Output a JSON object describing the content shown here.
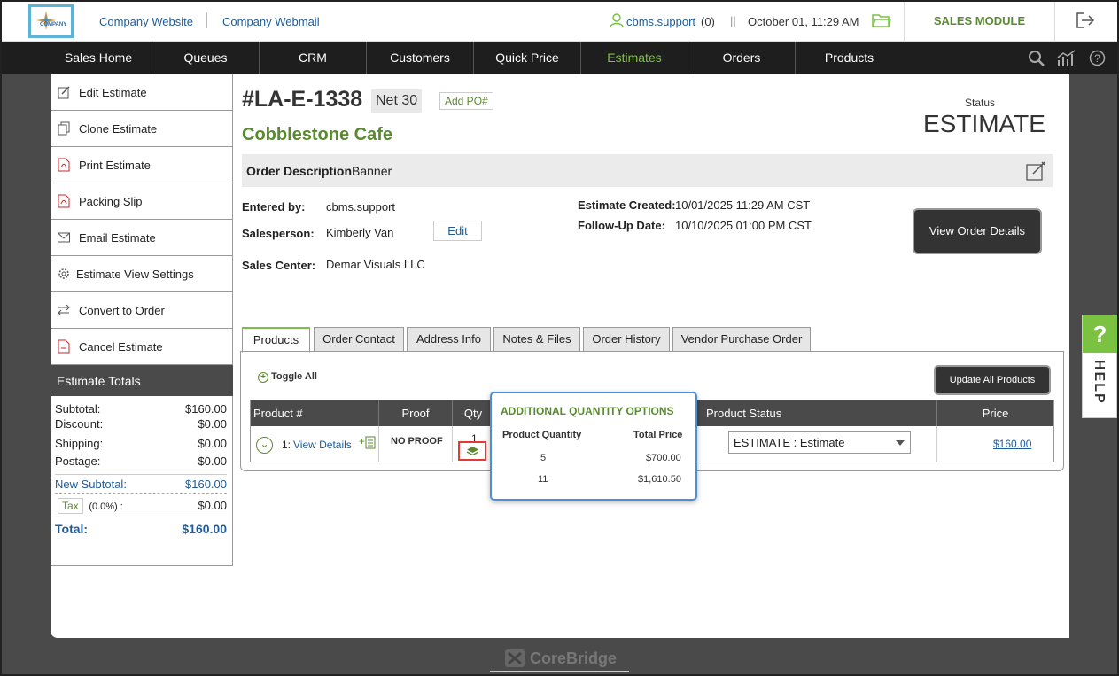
{
  "header": {
    "website_link": "Company Website",
    "webmail_link": "Company Webmail",
    "user": "cbms.support",
    "user_count": "(0)",
    "datetime": "October 01, 11:29 AM",
    "module": "SALES MODULE",
    "logo_text": "COMPANY"
  },
  "nav": {
    "items": [
      "Sales Home",
      "Queues",
      "CRM",
      "Customers",
      "Quick Price",
      "Estimates",
      "Orders",
      "Products"
    ],
    "active": "Estimates"
  },
  "sidebar": {
    "items": [
      {
        "label": "Edit Estimate",
        "icon": "edit-icon"
      },
      {
        "label": "Clone Estimate",
        "icon": "copy-icon"
      },
      {
        "label": "Print Estimate",
        "icon": "pdf-icon"
      },
      {
        "label": "Packing Slip",
        "icon": "pdf-icon"
      },
      {
        "label": "Email Estimate",
        "icon": "envelope-icon"
      },
      {
        "label": "Estimate View Settings",
        "icon": "gear-icon"
      },
      {
        "label": "Convert to Order",
        "icon": "swap-icon"
      },
      {
        "label": "Cancel Estimate",
        "icon": "pdf-icon"
      }
    ]
  },
  "totals": {
    "title": "Estimate Totals",
    "subtotal_label": "Subtotal:",
    "subtotal": "$160.00",
    "discount_label": "Discount:",
    "discount": "$0.00",
    "shipping_label": "Shipping:",
    "shipping": "$0.00",
    "postage_label": "Postage:",
    "postage": "$0.00",
    "new_subtotal_label": "New Subtotal:",
    "new_subtotal": "$160.00",
    "tax_label": "Tax",
    "tax_rate": "(0.0%) :",
    "tax": "$0.00",
    "total_label": "Total:",
    "total": "$160.00"
  },
  "estimate": {
    "number": "#LA-E-1338",
    "terms": "Net 30",
    "add_po": "Add PO#",
    "customer": "Cobblestone Cafe",
    "status_label": "Status",
    "status": "ESTIMATE",
    "desc_label": "Order Description:",
    "desc": "Banner",
    "entered_by_label": "Entered by:",
    "entered_by": "cbms.support",
    "salesperson_label": "Salesperson:",
    "salesperson": "Kimberly Van",
    "edit": "Edit",
    "sales_center_label": "Sales Center:",
    "sales_center": "Demar Visuals LLC",
    "created_label": "Estimate Created:",
    "created": "10/01/2025 11:29 AM CST",
    "followup_label": "Follow-Up Date:",
    "followup": "10/10/2025 01:00 PM CST",
    "view_order_details": "View Order Details"
  },
  "tabs": [
    "Products",
    "Order Contact",
    "Address Info",
    "Notes & Files",
    "Order History",
    "Vendor Purchase Order"
  ],
  "products": {
    "toggle_all": "Toggle All",
    "update_all": "Update All Products",
    "headers": {
      "product": "Product #",
      "proof": "Proof",
      "qty": "Qty",
      "status": "Product Status",
      "price": "Price"
    },
    "row": {
      "num": "1:",
      "view_details": "View Details",
      "proof": "NO PROOF",
      "qty": "1",
      "status": "ESTIMATE : Estimate",
      "price": "$160.00"
    }
  },
  "popover": {
    "title": "ADDITIONAL QUANTITY OPTIONS",
    "col_qty": "Product Quantity",
    "col_price": "Total Price",
    "rows": [
      {
        "qty": "5",
        "price": "$700.00"
      },
      {
        "qty": "11",
        "price": "$1,610.50"
      }
    ]
  },
  "help": {
    "q": "?",
    "label": "HELP"
  },
  "footer": {
    "brand": "CoreBridge"
  }
}
